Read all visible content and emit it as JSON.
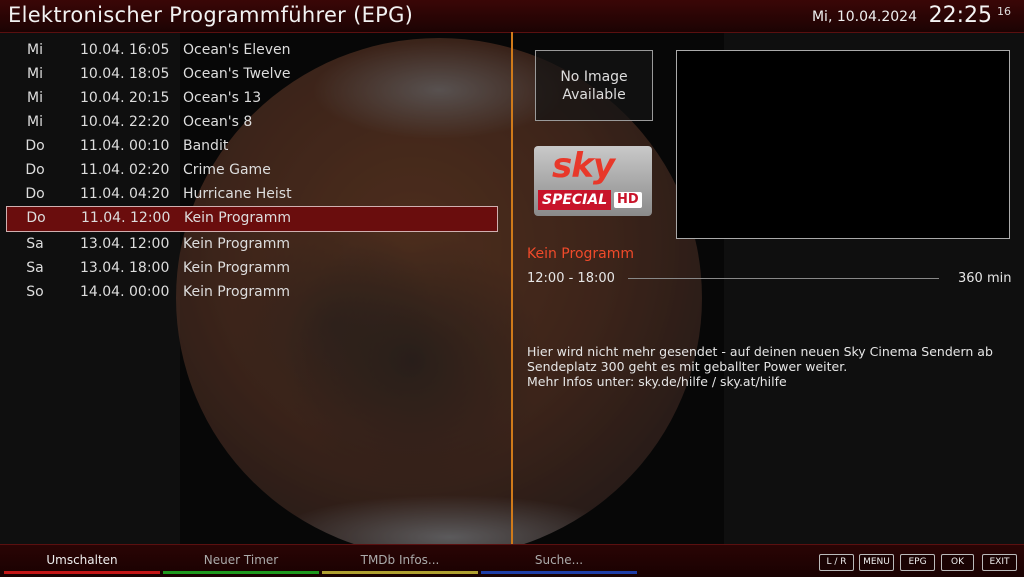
{
  "header": {
    "title": "Elektronischer Programmführer (EPG)",
    "date": "Mi, 10.04.2024",
    "time": "22:25",
    "seconds": "16"
  },
  "epg_list": [
    {
      "day": "Mi",
      "date": "10.04.",
      "time": "16:05",
      "title": "Ocean's Eleven",
      "selected": false
    },
    {
      "day": "Mi",
      "date": "10.04.",
      "time": "18:05",
      "title": "Ocean's Twelve",
      "selected": false
    },
    {
      "day": "Mi",
      "date": "10.04.",
      "time": "20:15",
      "title": "Ocean's 13",
      "selected": false
    },
    {
      "day": "Mi",
      "date": "10.04.",
      "time": "22:20",
      "title": "Ocean's 8",
      "selected": false
    },
    {
      "day": "Do",
      "date": "11.04.",
      "time": "00:10",
      "title": "Bandit",
      "selected": false
    },
    {
      "day": "Do",
      "date": "11.04.",
      "time": "02:20",
      "title": "Crime Game",
      "selected": false
    },
    {
      "day": "Do",
      "date": "11.04.",
      "time": "04:20",
      "title": "Hurricane Heist",
      "selected": false
    },
    {
      "day": "Do",
      "date": "11.04.",
      "time": "12:00",
      "title": "Kein Programm",
      "selected": true
    },
    {
      "day": "Sa",
      "date": "13.04.",
      "time": "12:00",
      "title": "Kein Programm",
      "selected": false
    },
    {
      "day": "Sa",
      "date": "13.04.",
      "time": "18:00",
      "title": "Kein Programm",
      "selected": false
    },
    {
      "day": "So",
      "date": "14.04.",
      "time": "00:00",
      "title": "Kein Programm",
      "selected": false
    }
  ],
  "detail": {
    "no_image_line1": "No Image",
    "no_image_line2": "Available",
    "channel_logo": {
      "brand": "sky",
      "label": "SPECIAL",
      "badge": "HD"
    },
    "program_title": "Kein Programm",
    "time_range": "12:00 - 18:00",
    "duration": "360 min",
    "progress_fraction": 0,
    "description_lines": [
      "Hier wird nicht mehr gesendet - auf deinen neuen Sky Cinema Sendern ab",
      "Sendeplatz 300 geht es mit geballter Power weiter.",
      "Mehr Infos unter: sky.de/hilfe / sky.at/hilfe"
    ]
  },
  "footer": {
    "red": "Umschalten",
    "green": "Neuer Timer",
    "yellow": "TMDb Infos...",
    "blue": "Suche...",
    "keys": [
      "L / R",
      "MENU",
      "EPG",
      "OK",
      "EXIT"
    ]
  },
  "colors": {
    "accent_red": "#c41616",
    "accent_green": "#1e9a1e",
    "accent_yellow": "#b0a030",
    "accent_blue": "#1e3ea8",
    "divider_orange": "#d07a1a",
    "program_title": "#f04a2a",
    "selected_row": "#6a0d0d"
  }
}
